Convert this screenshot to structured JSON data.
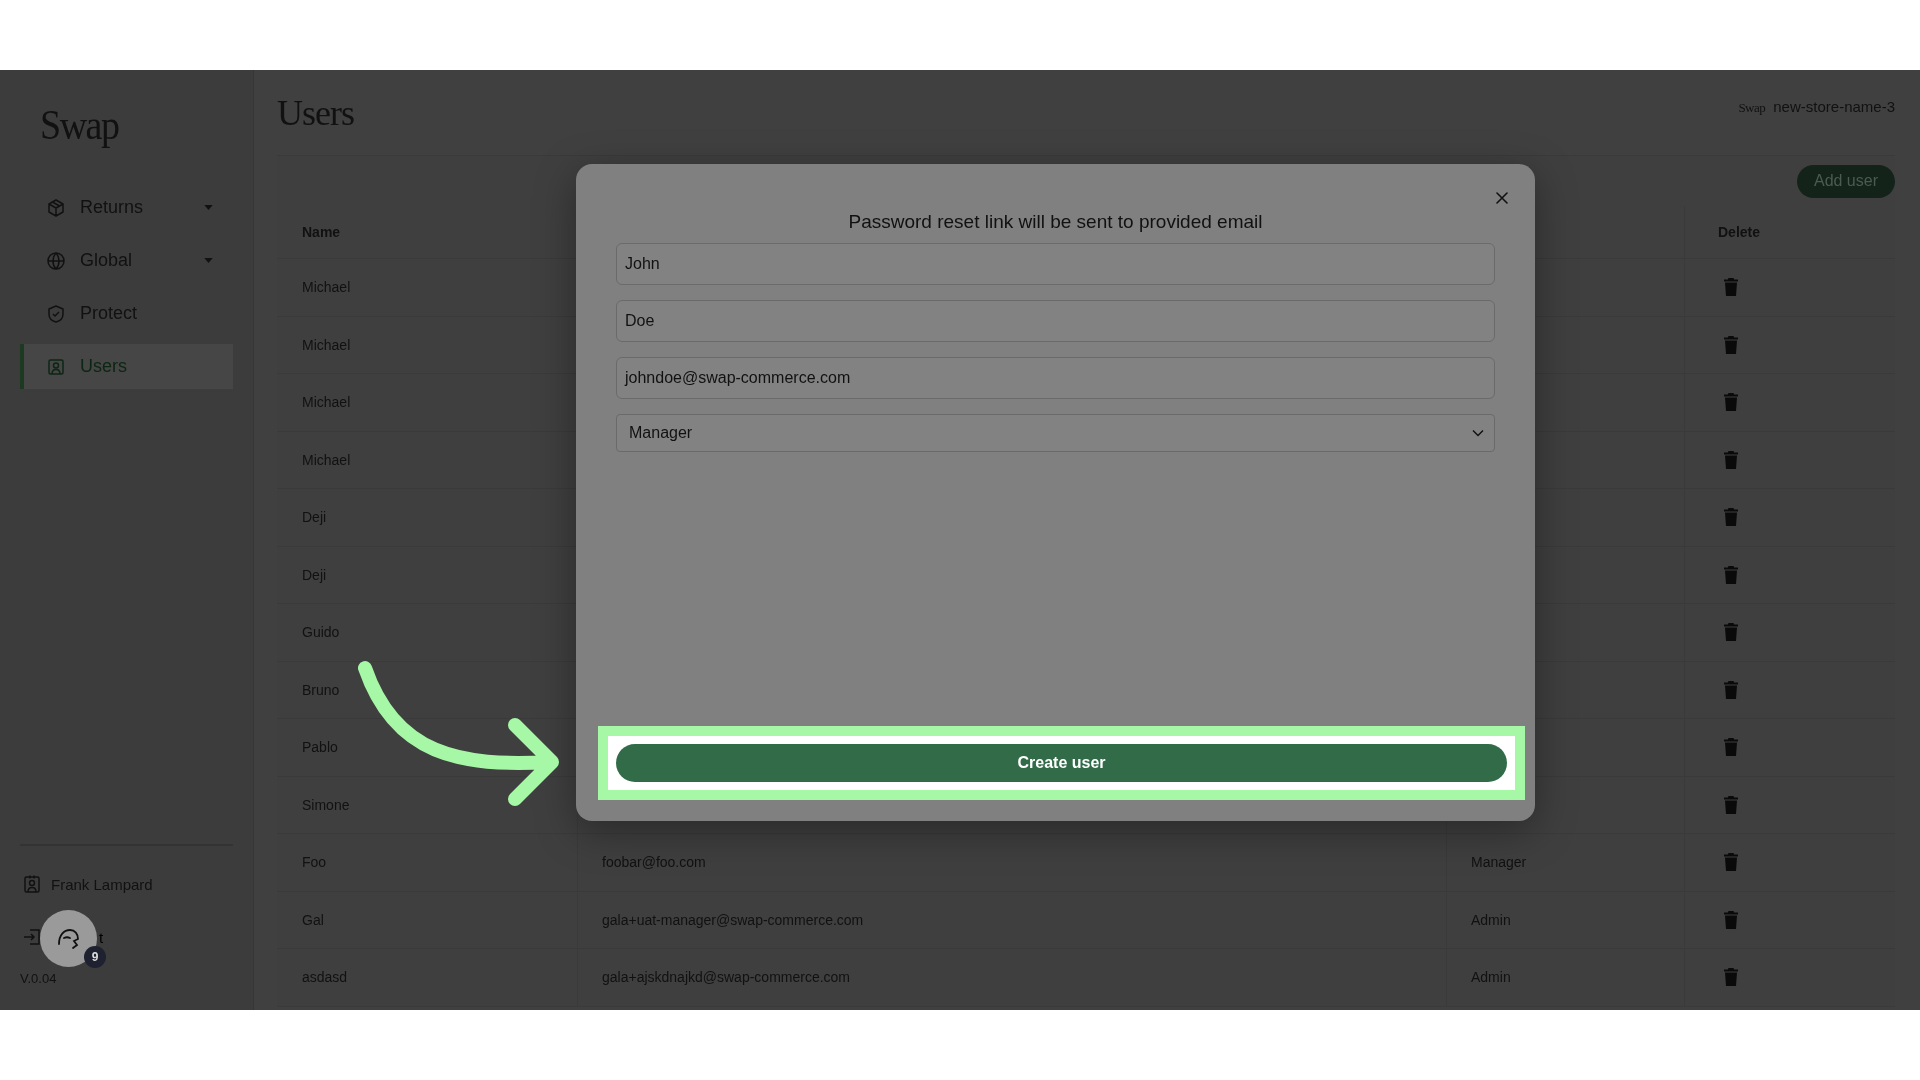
{
  "sidebar": {
    "logo": "Swap",
    "items": [
      {
        "label": "Returns",
        "kind": "dropdown",
        "selected": false
      },
      {
        "label": "Global",
        "kind": "dropdown",
        "selected": false
      },
      {
        "label": "Protect",
        "kind": "link",
        "selected": false
      },
      {
        "label": "Users",
        "kind": "link",
        "selected": true
      }
    ],
    "user": "Frank Lampard",
    "logout": "t",
    "version": "V.0.04"
  },
  "header": {
    "title": "Users",
    "store_logo": "Swap",
    "store_name": "new-store-name-3"
  },
  "add_button": "Add user",
  "table": {
    "columns": [
      "Name",
      "Delete"
    ],
    "rows": [
      {
        "name": "Michael"
      },
      {
        "name": "Michael"
      },
      {
        "name": "Michael"
      },
      {
        "name": "Michael"
      },
      {
        "name": "Deji"
      },
      {
        "name": "Deji"
      },
      {
        "name": "Guido"
      },
      {
        "name": "Bruno"
      },
      {
        "name": "Pablo"
      },
      {
        "name": "Simone"
      },
      {
        "name": "Foo",
        "email": "foobar@foo.com",
        "role": "Manager"
      },
      {
        "name": "Gal",
        "email": "gala+uat-manager@swap-commerce.com",
        "role": "Admin"
      },
      {
        "name": "asdasd",
        "email": "gala+ajskdnajkd@swap-commerce.com",
        "role": "Admin"
      }
    ]
  },
  "modal": {
    "title": "Password reset link will be sent to provided email",
    "fields": [
      {
        "kind": "text",
        "value": "John"
      },
      {
        "kind": "text",
        "value": "Doe"
      },
      {
        "kind": "text",
        "value": "johndoe@swap-commerce.com"
      },
      {
        "kind": "select",
        "value": "Manager"
      }
    ],
    "submit": "Create user"
  },
  "chat_badge": "9"
}
